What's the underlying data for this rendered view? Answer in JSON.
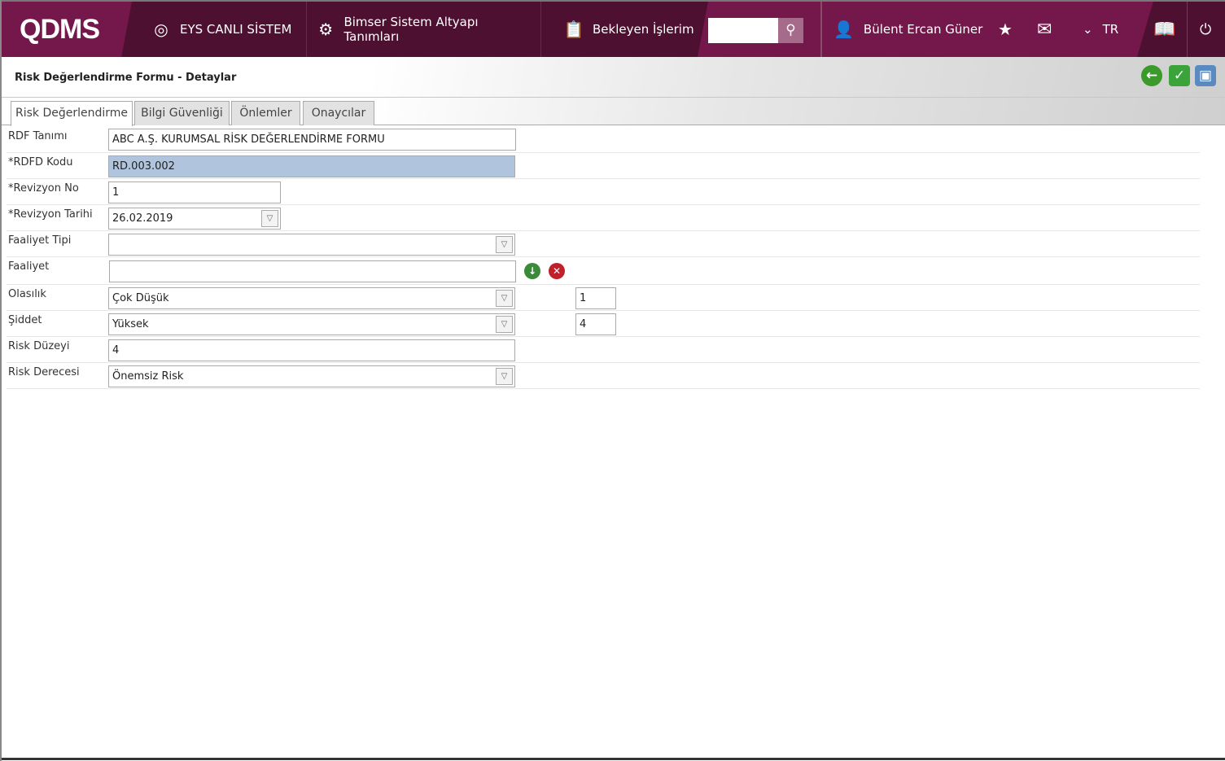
{
  "header": {
    "logo": "QDMS",
    "system": "EYS CANLI SİSTEM",
    "setup": "Bimser Sistem Altyapı Tanımları",
    "pending": "Bekleyen İşlerim",
    "search_value": "",
    "user": "Bülent Ercan Güner",
    "lang": "TR"
  },
  "page": {
    "title": "Risk Değerlendirme Formu - Detaylar"
  },
  "tabs": [
    {
      "label": "Risk Değerlendirme"
    },
    {
      "label": "Bilgi Güvenliği"
    },
    {
      "label": "Önlemler"
    },
    {
      "label": "Onaycılar"
    }
  ],
  "form": {
    "rdf_tanimi": {
      "label": "RDF Tanımı",
      "value": "ABC A.Ş. KURUMSAL RİSK DEĞERLENDİRME FORMU"
    },
    "rdfd_kodu": {
      "label": "*RDFD Kodu",
      "value": "RD.003.002"
    },
    "revizyon_no": {
      "label": "*Revizyon No",
      "value": "1"
    },
    "revizyon_tarihi": {
      "label": "*Revizyon Tarihi",
      "value": "26.02.2019"
    },
    "faaliyet_tipi": {
      "label": "Faaliyet Tipi",
      "value": ""
    },
    "faaliyet": {
      "label": "Faaliyet",
      "value": ""
    },
    "olasilik": {
      "label": "Olasılık",
      "value": "Çok Düşük",
      "score": "1"
    },
    "siddet": {
      "label": "Şiddet",
      "value": "Yüksek",
      "score": "4"
    },
    "risk_duzeyi": {
      "label": "Risk Düzeyi",
      "value": "4"
    },
    "risk_derecesi": {
      "label": "Risk Derecesi",
      "value": "Önemsiz Risk"
    }
  }
}
